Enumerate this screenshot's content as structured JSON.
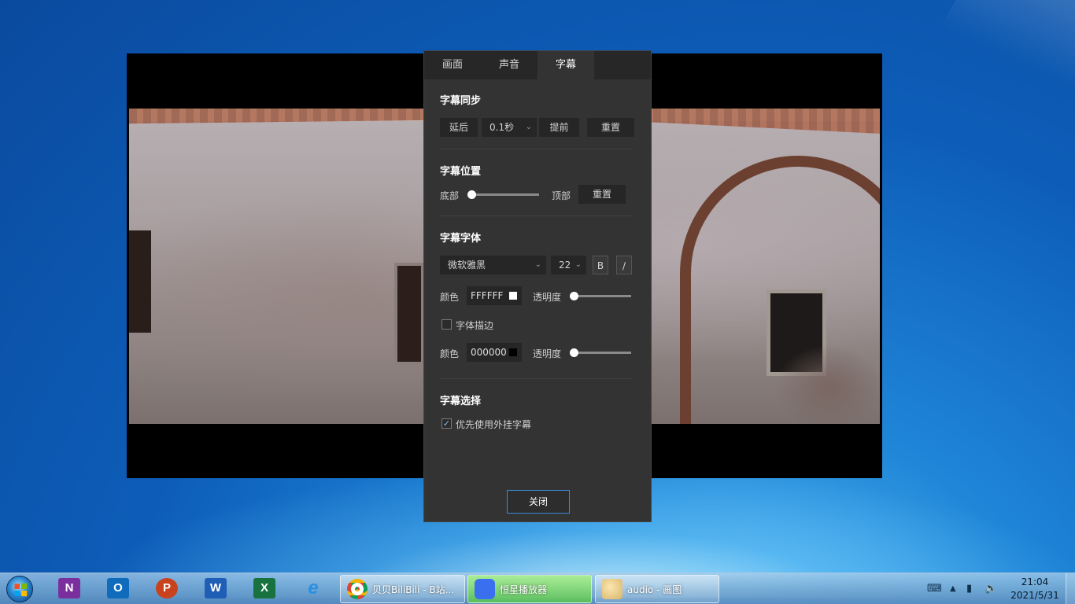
{
  "panel": {
    "tabs": [
      {
        "label": "画面"
      },
      {
        "label": "声音"
      },
      {
        "label": "字幕"
      }
    ],
    "sync": {
      "title": "字幕同步",
      "delay_label": "延后",
      "step_value": "0.1秒",
      "advance_label": "提前",
      "reset_label": "重置"
    },
    "position": {
      "title": "字幕位置",
      "bottom_label": "底部",
      "top_label": "顶部",
      "reset_label": "重置",
      "slider_value": 0
    },
    "font": {
      "title": "字幕字体",
      "family": "微软雅黑",
      "size": "22",
      "bold_label": "B",
      "italic_label": "/",
      "color_label": "颜色",
      "color_value": "FFFFFF",
      "opacity_label": "透明度",
      "opacity_value": 0,
      "outline_label": "字体描边",
      "outline_checked": false,
      "outline_color_label": "颜色",
      "outline_color_value": "000000",
      "outline_opacity_label": "透明度",
      "outline_opacity_value": 0
    },
    "selection": {
      "title": "字幕选择",
      "prefer_external_label": "优先使用外挂字幕",
      "prefer_external_checked": true
    },
    "close_label": "关闭"
  },
  "taskbar": {
    "pinned": [
      {
        "name": "onenote-icon",
        "letter": "N",
        "color": "#7b2f9e"
      },
      {
        "name": "outlook-icon",
        "letter": "O",
        "color": "#0f6cbd"
      },
      {
        "name": "powerpoint-icon",
        "letter": "P",
        "color": "#c9421e"
      },
      {
        "name": "word-icon",
        "letter": "W",
        "color": "#1f5eb5"
      },
      {
        "name": "excel-icon",
        "letter": "X",
        "color": "#17723f"
      },
      {
        "name": "ie-icon",
        "letter": "e",
        "color": "#2a8fe0"
      }
    ],
    "tasks": [
      {
        "label": "贝贝BiliBili - B站..."
      },
      {
        "label": "恒星播放器"
      },
      {
        "label": "audio - 画图"
      }
    ],
    "clock_time": "21:04",
    "clock_date": "2021/5/31"
  },
  "colors": {
    "accent": "#3b8ad6",
    "panel_bg": "#333333",
    "tab_bar_bg": "#272727"
  }
}
